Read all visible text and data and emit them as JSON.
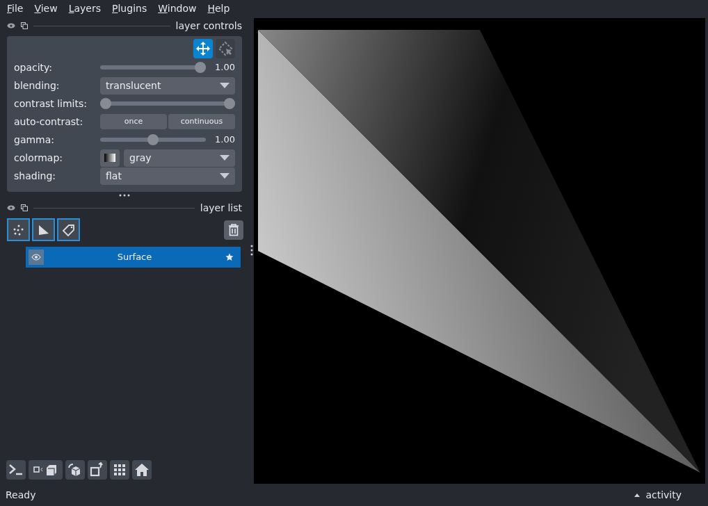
{
  "menu": [
    {
      "label": "File"
    },
    {
      "label": "View"
    },
    {
      "label": "Layers"
    },
    {
      "label": "Plugins"
    },
    {
      "label": "Window"
    },
    {
      "label": "Help"
    }
  ],
  "layer_controls": {
    "title": "layer controls",
    "modes": [
      {
        "kind": "move",
        "selected": true
      },
      {
        "kind": "transform",
        "selected": false
      }
    ],
    "rows": [
      {
        "kind": "slider",
        "label": "opacity:",
        "level": 1,
        "reading": "1.00"
      },
      {
        "kind": "dropdown",
        "label": "blending:",
        "value": "translucent"
      },
      {
        "kind": "range",
        "label": "contrast limits:",
        "thumbs": [
          {
            "level": 0
          },
          {
            "level": 1
          }
        ]
      },
      {
        "kind": "buttons",
        "label": "auto-contrast:",
        "buttons": [
          "once",
          "continuous"
        ]
      },
      {
        "kind": "slider",
        "label": "gamma:",
        "level": 0.5,
        "reading": "1.00"
      },
      {
        "kind": "colormap",
        "label": "colormap:",
        "value": "gray"
      },
      {
        "kind": "dropdown",
        "label": "shading:",
        "value": "flat"
      }
    ]
  },
  "layer_list": {
    "title": "layer list",
    "new_layer_buttons": [
      {
        "kind": "points"
      },
      {
        "kind": "shapes"
      },
      {
        "kind": "labels"
      }
    ],
    "layers": [
      {
        "name": "Surface",
        "visible": true,
        "selected": true
      }
    ]
  },
  "bottom_buttons": [
    {
      "kind": "console"
    },
    {
      "kind": "ndisplay"
    },
    {
      "kind": "roll"
    },
    {
      "kind": "transpose"
    },
    {
      "kind": "grid"
    },
    {
      "kind": "home"
    }
  ],
  "status_bar": {
    "message": "Ready",
    "activity": "activity"
  }
}
